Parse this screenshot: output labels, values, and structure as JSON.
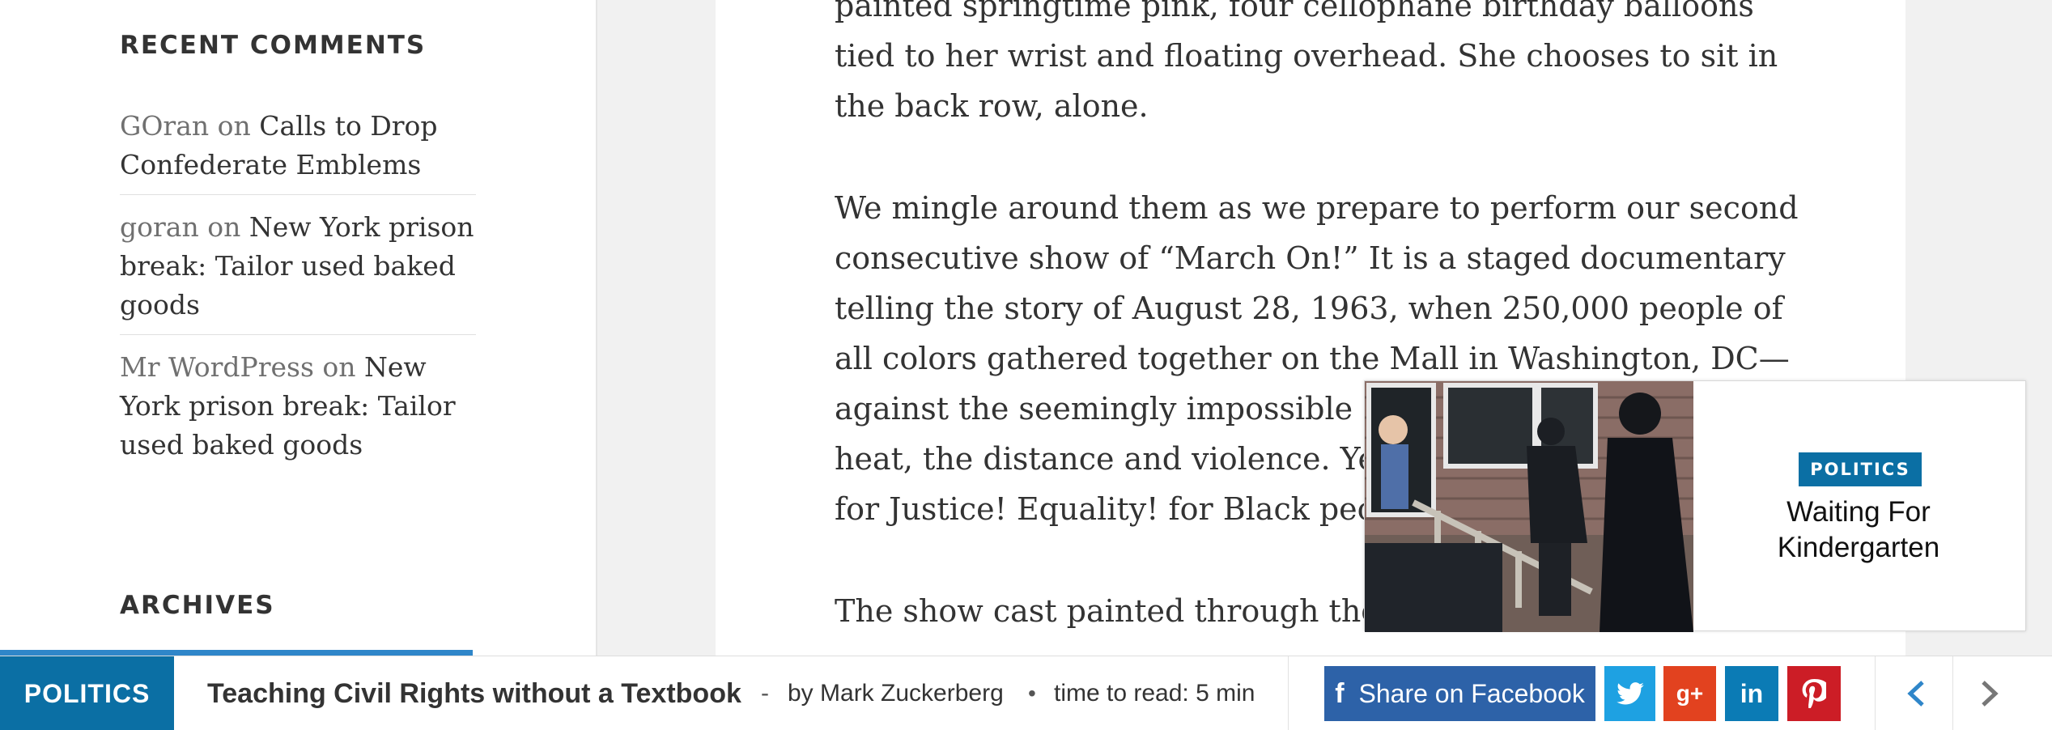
{
  "sidebar": {
    "recent_comments_title": "RECENT COMMENTS",
    "comments": [
      {
        "author": "GOran",
        "on": "on",
        "post": "Calls to Drop Confederate Emblems"
      },
      {
        "author": "goran",
        "on": "on",
        "post": "New York prison break: Tailor used baked goods"
      },
      {
        "author": "Mr WordPress",
        "on": "on",
        "post": "New York prison break: Tailor used baked goods"
      }
    ],
    "archives_title": "ARCHIVES"
  },
  "article": {
    "paragraphs": [
      "painted springtime pink, four cellophane birthday balloons tied to her wrist and floating overhead. She chooses to sit in the back row, alone.",
      "We mingle around them as we prepare to perform our second consecutive show of “March On!” It is a staged documentary telling the story of August 28, 1963, when 250,000 people of all colors gathered together on the Mall in Washington, DC—against the seemingly impossible odds of segregation, the heat, the distance and violence. Yet everyone stood peaceful for Justice! Equality! for Black people.",
      "The show cast painted through the generation of the people"
    ]
  },
  "popup": {
    "category": "POLITICS",
    "title": "Waiting For Kindergarten",
    "image_icon": "news-photo-police-at-house"
  },
  "bottom_bar": {
    "category": "POLITICS",
    "title": "Teaching Civil Rights without a Textbook",
    "dash": "-",
    "author": "by Mark Zuckerberg",
    "dot": "•",
    "read_time": "time to read: 5 min",
    "share_facebook_label": "Share on Facebook",
    "share_facebook_icon": "f",
    "share_googleplus_label": "g+",
    "share_linkedin_label": "in"
  },
  "colors": {
    "politics_blue": "#0b6fa4",
    "facebook": "#2d62a8",
    "twitter": "#1ea1e2",
    "googleplus": "#e2421f",
    "linkedin": "#0b7bb5",
    "pinterest": "#cc1d26",
    "archives_bar": "#2f86c9"
  }
}
